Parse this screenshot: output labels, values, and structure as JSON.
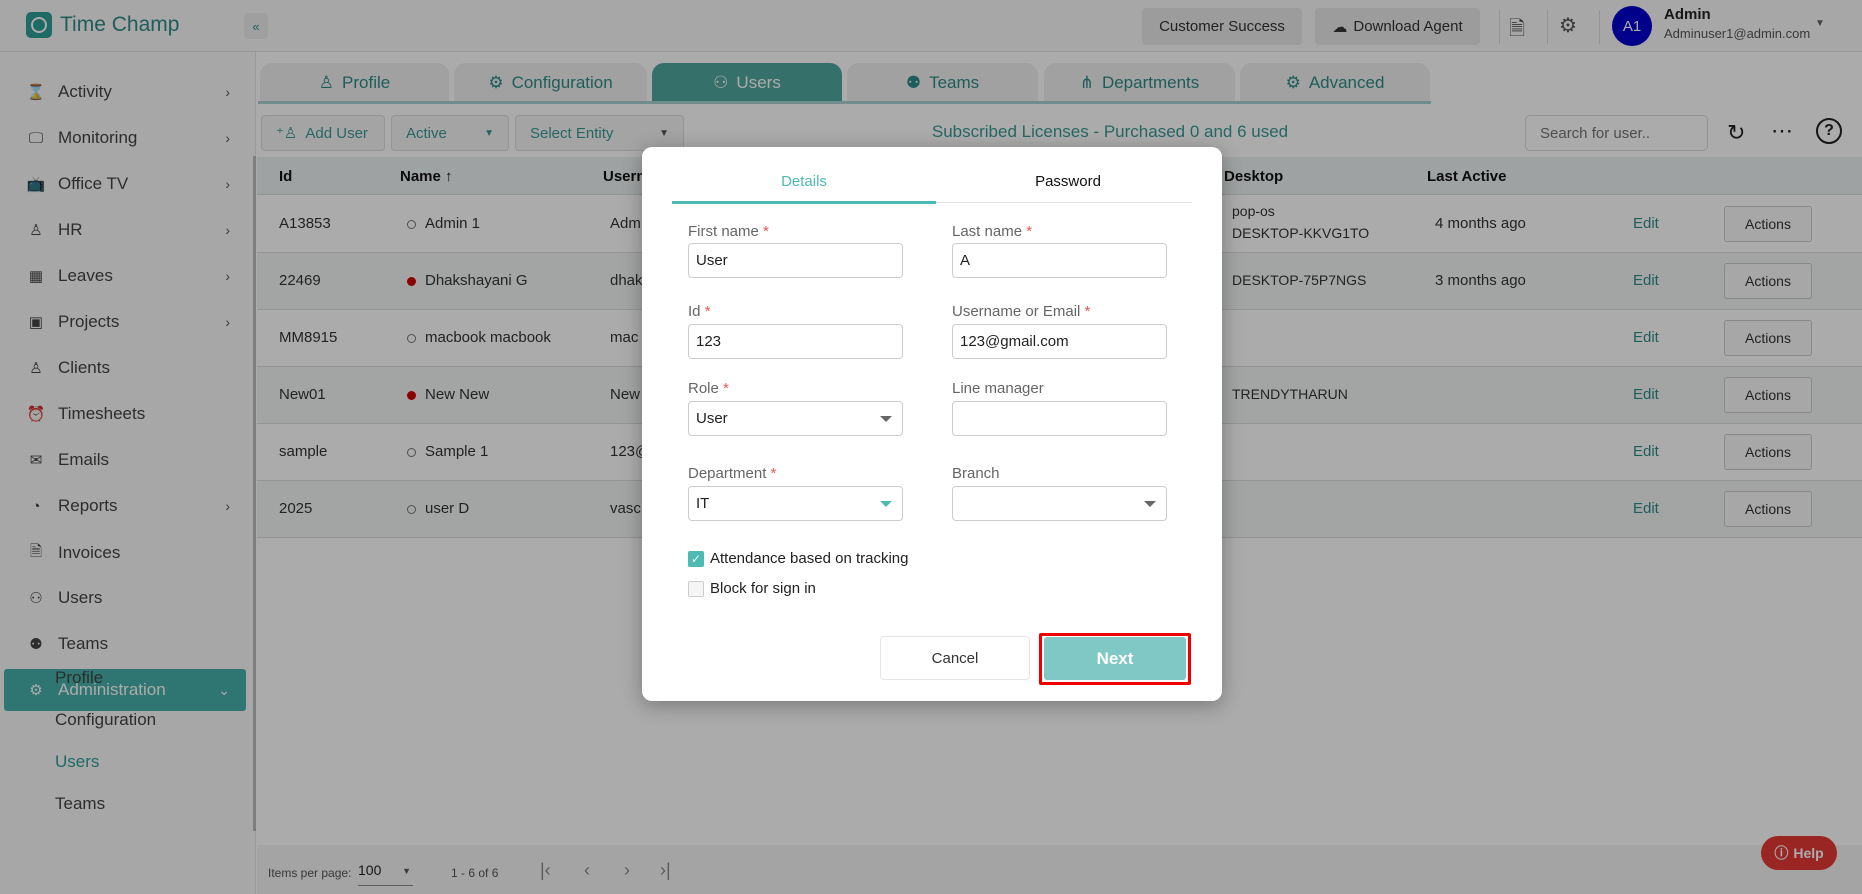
{
  "app": {
    "name": "Time Champ",
    "collapse_icon": "«"
  },
  "header": {
    "customer_success": "Customer Success",
    "download_agent": "Download Agent",
    "user_initials": "A1",
    "user_name": "Admin",
    "user_email": "Adminuser1@admin.com"
  },
  "sidebar": {
    "items": [
      {
        "label": "Activity",
        "icon": "activity-icon",
        "glyph": "⌛",
        "chevron": true
      },
      {
        "label": "Monitoring",
        "icon": "monitor-icon",
        "glyph": "🖵",
        "chevron": true
      },
      {
        "label": "Office TV",
        "icon": "tv-icon",
        "glyph": "📺",
        "chevron": true
      },
      {
        "label": "HR",
        "icon": "person-icon",
        "glyph": "♙",
        "chevron": true
      },
      {
        "label": "Leaves",
        "icon": "calendar-icon",
        "glyph": "▦",
        "chevron": true
      },
      {
        "label": "Projects",
        "icon": "briefcase-icon",
        "glyph": "▣",
        "chevron": true
      },
      {
        "label": "Clients",
        "icon": "client-icon",
        "glyph": "♙",
        "chevron": false
      },
      {
        "label": "Timesheets",
        "icon": "clock-icon",
        "glyph": "⏰",
        "chevron": false
      },
      {
        "label": "Emails",
        "icon": "mail-icon",
        "glyph": "✉",
        "chevron": false
      },
      {
        "label": "Reports",
        "icon": "pie-chart-icon",
        "glyph": "◔",
        "chevron": true
      },
      {
        "label": "Invoices",
        "icon": "invoice-icon",
        "glyph": "🗎",
        "chevron": false
      },
      {
        "label": "Users",
        "icon": "users-icon",
        "glyph": "⚇",
        "chevron": false
      },
      {
        "label": "Teams",
        "icon": "teams-icon",
        "glyph": "⚉",
        "chevron": false
      },
      {
        "label": "Administration",
        "icon": "gear-icon",
        "glyph": "⚙",
        "chevron": true,
        "active": true
      }
    ],
    "subitems": [
      {
        "label": "Profile"
      },
      {
        "label": "Configuration"
      },
      {
        "label": "Users",
        "active": true
      },
      {
        "label": "Teams"
      }
    ]
  },
  "tabs": [
    {
      "label": "Profile",
      "icon": "profile-icon",
      "glyph": "♙"
    },
    {
      "label": "Configuration",
      "icon": "gears-icon",
      "glyph": "⚙"
    },
    {
      "label": "Users",
      "icon": "users-icon",
      "glyph": "⚇",
      "active": true
    },
    {
      "label": "Teams",
      "icon": "teams-icon",
      "glyph": "⚉"
    },
    {
      "label": "Departments",
      "icon": "hierarchy-icon",
      "glyph": "⋔"
    },
    {
      "label": "Advanced",
      "icon": "advanced-gear-icon",
      "glyph": "⚙"
    }
  ],
  "toolbar": {
    "add_user": "Add User",
    "status_filter": "Active",
    "entity_filter": "Select Entity",
    "license_text": "Subscribed Licenses - Purchased 0 and 6 used",
    "search_placeholder": "Search for user.."
  },
  "table": {
    "headers": {
      "id": "Id",
      "name": "Name",
      "username": "Usern",
      "desktop": "Desktop",
      "last_active": "Last Active"
    },
    "edit_label": "Edit",
    "actions_label": "Actions",
    "rows": [
      {
        "id": "A13853",
        "name": "Admin 1",
        "online": false,
        "username": "Adm",
        "desktop": "pop-os",
        "desktop2": "DESKTOP-KKVG1TO",
        "last_active": "4 months ago"
      },
      {
        "id": "22469",
        "name": "Dhakshayani G",
        "online": true,
        "username": "dhak",
        "desktop": "DESKTOP-75P7NGS",
        "desktop2": "",
        "last_active": "3 months ago"
      },
      {
        "id": "MM8915",
        "name": "macbook macbook",
        "online": false,
        "username": "mac",
        "desktop": "",
        "desktop2": "",
        "last_active": ""
      },
      {
        "id": "New01",
        "name": "New New",
        "online": true,
        "username": "New",
        "desktop": "TRENDYTHARUN",
        "desktop2": "",
        "last_active": ""
      },
      {
        "id": "sample",
        "name": "Sample 1",
        "online": false,
        "username": "123@",
        "desktop": "",
        "desktop2": "",
        "last_active": ""
      },
      {
        "id": "2025",
        "name": "user D",
        "online": false,
        "username": "vasc",
        "desktop": "",
        "desktop2": "",
        "last_active": ""
      }
    ]
  },
  "pagination": {
    "items_per_page_label": "Items per page:",
    "items_per_page": "100",
    "range": "1 - 6 of 6"
  },
  "help": {
    "label": "Help"
  },
  "modal": {
    "tabs": {
      "details": "Details",
      "password": "Password"
    },
    "fields": {
      "first_name": {
        "label": "First name",
        "value": "User"
      },
      "last_name": {
        "label": "Last name",
        "value": "A"
      },
      "id": {
        "label": "Id",
        "value": "123"
      },
      "username": {
        "label": "Username or Email",
        "value": "123@gmail.com"
      },
      "role": {
        "label": "Role",
        "value": "User"
      },
      "line_manager": {
        "label": "Line manager",
        "value": ""
      },
      "department": {
        "label": "Department",
        "value": "IT"
      },
      "branch": {
        "label": "Branch",
        "value": ""
      }
    },
    "required_mark": "*",
    "attendance_label": "Attendance based on tracking",
    "attendance_checked": true,
    "block_label": "Block for sign in",
    "block_checked": false,
    "cancel": "Cancel",
    "next": "Next"
  },
  "colors": {
    "accent": "#46b0aa",
    "avatar": "#0000d0",
    "online_dot": "#d00000",
    "help": "#e53935"
  }
}
